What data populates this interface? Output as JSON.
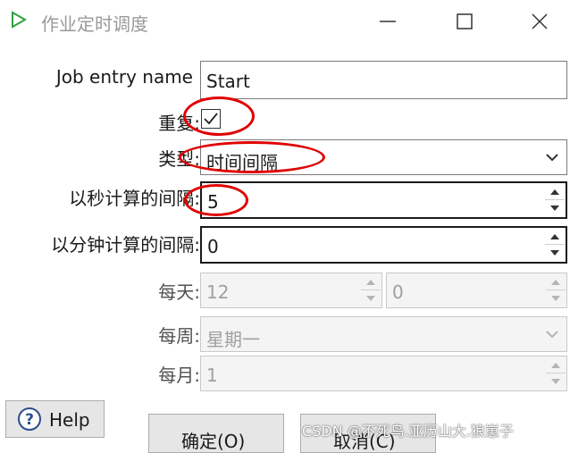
{
  "window": {
    "title": "作业定时调度"
  },
  "form": {
    "job_entry_name": {
      "label": "Job entry name",
      "value": "Start"
    },
    "repeat": {
      "label": "重复:",
      "checked": true
    },
    "type": {
      "label": "类型:",
      "value": "时间间隔"
    },
    "interval_seconds": {
      "label": "以秒计算的间隔:",
      "value": "5"
    },
    "interval_minutes": {
      "label": "以分钟计算的间隔:",
      "value": "0"
    },
    "daily": {
      "label": "每天:",
      "hour": "12",
      "minute": "0"
    },
    "weekly": {
      "label": "每周:",
      "value": "星期一"
    },
    "monthly": {
      "label": "每月:",
      "value": "1"
    }
  },
  "buttons": {
    "help": "Help",
    "ok": "确定(O)",
    "cancel": "取消(C)"
  },
  "watermark": "CSDN @不死鸟.亚历山大.狼崽子",
  "colors": {
    "annotation": "#e00000",
    "app_icon": "#2ea043"
  },
  "icons": [
    "play-icon",
    "minimize-icon",
    "maximize-icon",
    "close-icon",
    "checkmark-icon",
    "chevron-down-icon",
    "spin-up-icon",
    "spin-down-icon",
    "help-icon"
  ]
}
